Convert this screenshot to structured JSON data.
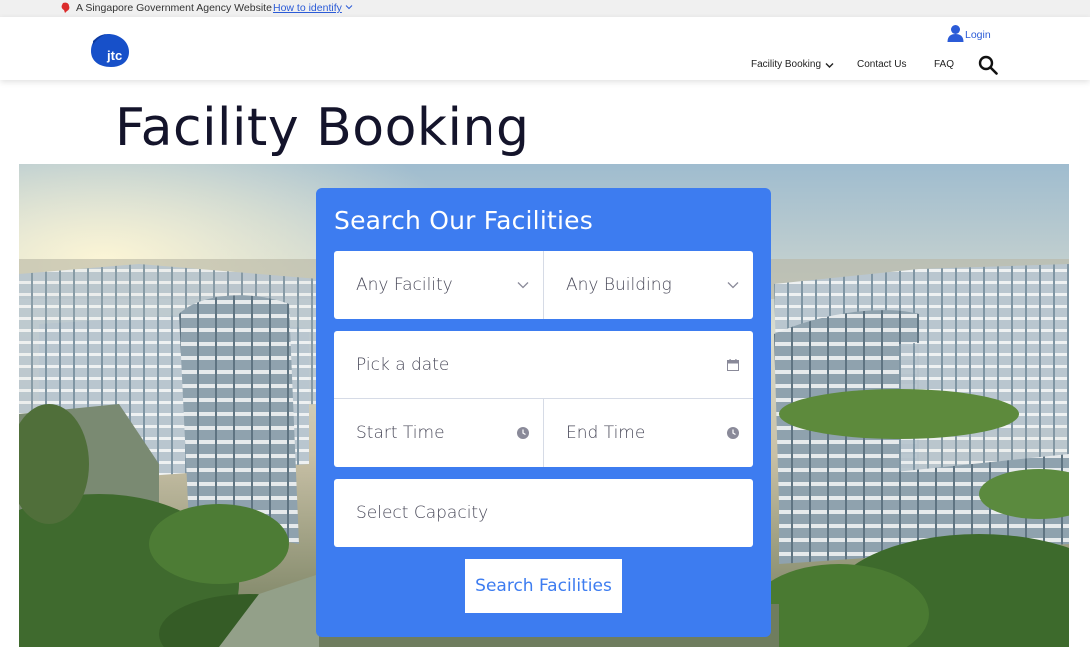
{
  "masthead": {
    "text": "A Singapore Government Agency Website",
    "link": "How to identify"
  },
  "header": {
    "logo_text": "jtc",
    "login_label": "Login",
    "nav": {
      "facility_booking": "Facility Booking",
      "contact_us": "Contact Us",
      "faq": "FAQ"
    }
  },
  "page": {
    "title": "Facility Booking"
  },
  "search": {
    "title": "Search Our Facilities",
    "facility_select": "Any Facility",
    "building_select": "Any Building",
    "date_placeholder": "Pick a date",
    "start_time_placeholder": "Start Time",
    "end_time_placeholder": "End Time",
    "capacity_placeholder": "Select Capacity",
    "submit_label": "Search Facilities"
  },
  "colors": {
    "accent": "#3d7cf0",
    "link": "#2b5bd7",
    "masthead_bg": "#f0f0f0"
  }
}
